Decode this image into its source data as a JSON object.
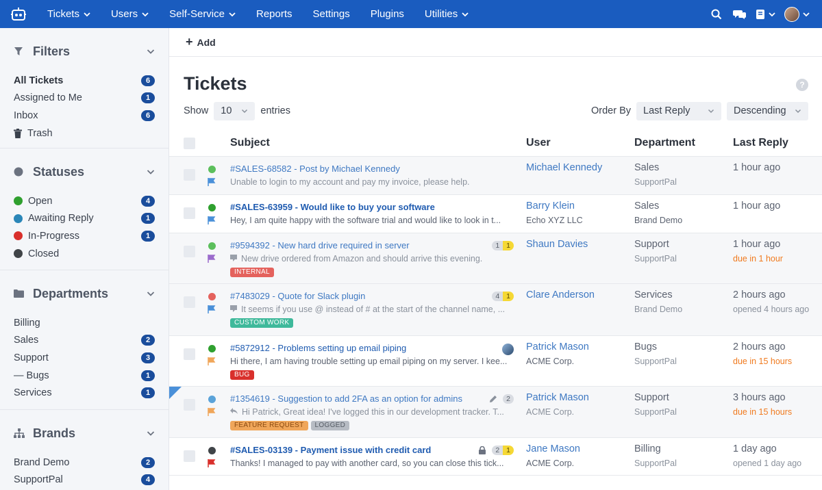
{
  "topnav": {
    "items": [
      "Tickets",
      "Users",
      "Self-Service",
      "Reports",
      "Settings",
      "Plugins",
      "Utilities"
    ],
    "dropdown": [
      true,
      true,
      true,
      false,
      false,
      false,
      true
    ]
  },
  "filters": {
    "title": "Filters",
    "items": [
      {
        "label": "All Tickets",
        "count": "6"
      },
      {
        "label": "Assigned to Me",
        "count": "1"
      },
      {
        "label": "Inbox",
        "count": "6"
      },
      {
        "label": "Trash",
        "count": ""
      }
    ]
  },
  "statuses": {
    "title": "Statuses",
    "items": [
      {
        "label": "Open",
        "count": "4",
        "color": "#2fa02f"
      },
      {
        "label": "Awaiting Reply",
        "count": "1",
        "color": "#2a86b8"
      },
      {
        "label": "In-Progress",
        "count": "1",
        "color": "#d9302c"
      },
      {
        "label": "Closed",
        "count": "",
        "color": "#404448"
      }
    ]
  },
  "departments": {
    "title": "Departments",
    "items": [
      {
        "label": "Billing",
        "count": ""
      },
      {
        "label": "Sales",
        "count": "2"
      },
      {
        "label": "Support",
        "count": "3"
      },
      {
        "label": "— Bugs",
        "count": "1"
      },
      {
        "label": "Services",
        "count": "1"
      }
    ]
  },
  "brands": {
    "title": "Brands",
    "items": [
      {
        "label": "Brand Demo",
        "count": "2"
      },
      {
        "label": "SupportPal",
        "count": "4"
      }
    ]
  },
  "toolbar": {
    "add_label": "Add"
  },
  "page": {
    "title": "Tickets",
    "show_label": "Show",
    "show_value": "10",
    "entries_label": "entries",
    "order_by_label": "Order By",
    "order_by_value": "Last Reply",
    "direction_value": "Descending"
  },
  "columns": {
    "subject": "Subject",
    "user": "User",
    "department": "Department",
    "last_reply": "Last Reply"
  },
  "tickets": [
    {
      "subject": "#SALES-68582 - Post by Michael Kennedy",
      "excerpt": "Unable to login to my account and pay my invoice, please help.",
      "user": "Michael Kennedy",
      "org": "",
      "department": "Sales",
      "brand": "SupportPal",
      "last_reply": "1 hour ago",
      "due": ""
    },
    {
      "subject": "#SALES-63959 - Would like to buy your software",
      "excerpt": "Hey, I am quite happy with the software trial and would like to look in t...",
      "user": "Barry Klein",
      "org": "Echo XYZ LLC",
      "department": "Sales",
      "brand": "Brand Demo",
      "last_reply": "1 hour ago",
      "due": ""
    },
    {
      "subject": "#9594392 - New hard drive required in server",
      "excerpt": "New drive ordered from Amazon and should arrive this evening.",
      "user": "Shaun Davies",
      "org": "",
      "department": "Support",
      "brand": "SupportPal",
      "last_reply": "1 hour ago",
      "due": "due in 1 hour",
      "tags": [
        "INTERNAL"
      ],
      "count_a": "1",
      "count_b": "1"
    },
    {
      "subject": "#7483029 - Quote for Slack plugin",
      "excerpt": "It seems if you use @ instead of # at the start of the channel name, ...",
      "user": "Clare Anderson",
      "org": "",
      "department": "Services",
      "brand": "Brand Demo",
      "last_reply": "2 hours ago",
      "due": "opened 4 hours ago",
      "tags": [
        "CUSTOM WORK"
      ],
      "count_a": "4",
      "count_b": "1"
    },
    {
      "subject": "#5872912 - Problems setting up email piping",
      "excerpt": "Hi there, I am having trouble setting up email piping on my server. I kee...",
      "user": "Patrick Mason",
      "org": "ACME Corp.",
      "department": "Bugs",
      "brand": "SupportPal",
      "last_reply": "2 hours ago",
      "due": "due in 15 hours",
      "tags": [
        "BUG"
      ]
    },
    {
      "subject": "#1354619 - Suggestion to add 2FA as an option for admins",
      "excerpt": "Hi Patrick, Great idea! I've logged this in our development tracker. T...",
      "user": "Patrick Mason",
      "org": "ACME Corp.",
      "department": "Support",
      "brand": "SupportPal",
      "last_reply": "3 hours ago",
      "due": "due in 15 hours",
      "tags": [
        "FEATURE REQUEST",
        "LOGGED"
      ],
      "count_a": "2"
    },
    {
      "subject": "#SALES-03139 - Payment issue with credit card",
      "excerpt": "Thanks! I managed to pay with another card, so you can close this tick...",
      "user": "Jane Mason",
      "org": "ACME Corp.",
      "department": "Billing",
      "brand": "SupportPal",
      "last_reply": "1 day ago",
      "due": "opened 1 day ago",
      "count_a": "2",
      "count_b": "1"
    }
  ],
  "colors": {
    "nav_bg": "#1a5cbf",
    "badge_bg": "#1a4d9c",
    "link": "#3e78c2",
    "due_orange": "#f07a1e",
    "tag_internal": "#e4625d",
    "tag_custom_work": "#3fb99b",
    "tag_bug": "#d9302c",
    "tag_feature_request": "#f0a65a",
    "tag_logged": "#b7bcc4",
    "flag_blue": "#4a90d9",
    "flag_purple": "#9b6bcc",
    "flag_orange": "#f0a65a",
    "flag_red": "#d9302c"
  },
  "icons": [
    "robot-logo-icon",
    "search-icon",
    "chat-icon",
    "notes-icon",
    "filter-icon",
    "trash-icon",
    "folder-icon",
    "sitemap-icon",
    "help-icon",
    "flag-icon",
    "lock-icon",
    "pencil-icon",
    "note-icon",
    "reply-icon"
  ]
}
